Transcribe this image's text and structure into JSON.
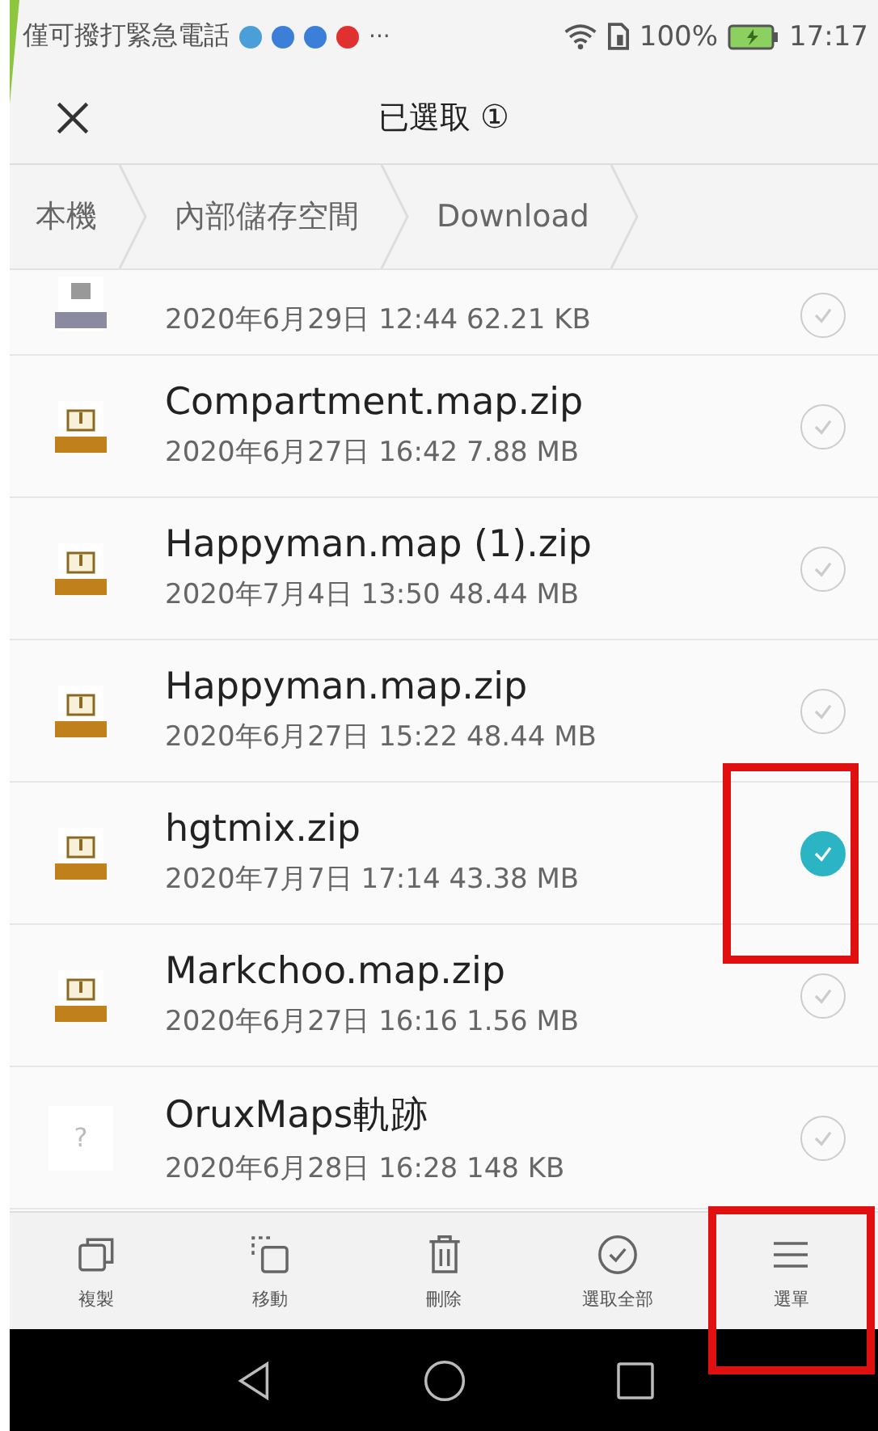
{
  "status_bar": {
    "carrier": "僅可撥打緊急電話",
    "notifications": [
      {
        "kind": "app"
      },
      {
        "kind": "facebook"
      },
      {
        "kind": "facebook"
      },
      {
        "kind": "video"
      }
    ],
    "more": "···",
    "battery": "100%",
    "time": "17:17"
  },
  "title_bar": {
    "title": "已選取",
    "count": "①"
  },
  "breadcrumbs": [
    {
      "label": "本機"
    },
    {
      "label": "內部儲存空間"
    },
    {
      "label": "Download"
    }
  ],
  "files": [
    {
      "kind": "xml",
      "meta": "2020年6月29日 12:44 62.21 KB",
      "selected": false
    },
    {
      "kind": "zip",
      "name": "Compartment.map.zip",
      "meta": "2020年6月27日 16:42 7.88 MB",
      "selected": false
    },
    {
      "kind": "zip",
      "name": "Happyman.map (1).zip",
      "meta": "2020年7月4日 13:50 48.44 MB",
      "selected": false
    },
    {
      "kind": "zip",
      "name": "Happyman.map.zip",
      "meta": "2020年6月27日 15:22 48.44 MB",
      "selected": false
    },
    {
      "kind": "zip",
      "name": "hgtmix.zip",
      "meta": "2020年7月7日 17:14 43.38 MB",
      "selected": true,
      "highlighted": true
    },
    {
      "kind": "zip",
      "name": "Markchoo.map.zip",
      "meta": "2020年6月27日 16:16 1.56 MB",
      "selected": false
    },
    {
      "kind": "unknown",
      "glyph": "?",
      "name": "OruxMaps軌跡",
      "meta": "2020年6月28日 16:28 148 KB",
      "selected": false
    }
  ],
  "actions": [
    {
      "kind": "copy",
      "label": "複製"
    },
    {
      "kind": "move",
      "label": "移動"
    },
    {
      "kind": "delete",
      "label": "刪除"
    },
    {
      "kind": "select-all",
      "label": "選取全部"
    },
    {
      "kind": "menu",
      "label": "選單",
      "highlighted": true
    }
  ]
}
